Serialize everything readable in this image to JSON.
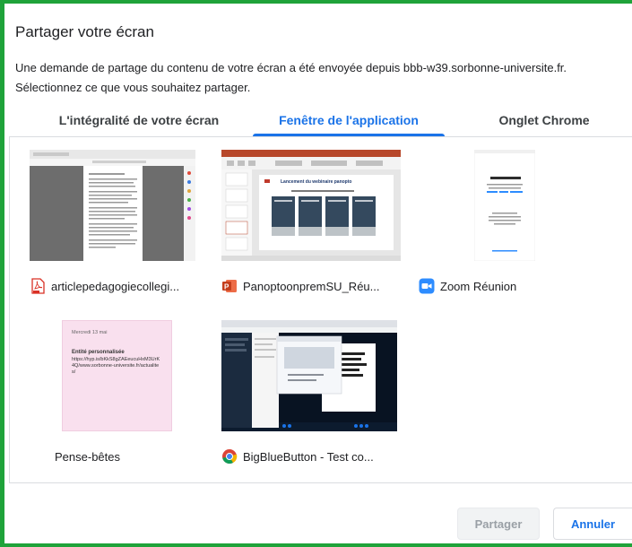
{
  "dialog": {
    "title": "Partager votre écran",
    "line1": "Une demande de partage du contenu de votre écran a été envoyée depuis bbb-w39.sorbonne-universite.fr.",
    "line2": "Sélectionnez ce que vous souhaitez partager."
  },
  "tabs": [
    {
      "label": "L'intégralité de votre écran",
      "active": false
    },
    {
      "label": "Fenêtre de l'application",
      "active": true
    },
    {
      "label": "Onglet Chrome",
      "active": false
    }
  ],
  "windows": [
    {
      "label": "articlepedagogiecollegi...",
      "icon": "pdf-icon"
    },
    {
      "label": "PanoptoonpremSU_Réu...",
      "icon": "powerpoint-icon"
    },
    {
      "label": "Zoom Réunion",
      "icon": "zoom-icon"
    },
    {
      "label": "Pense-bêtes",
      "icon": ""
    },
    {
      "label": "BigBlueButton - Test co...",
      "icon": "chrome-icon"
    }
  ],
  "thumbnails": {
    "ppt_slide_title": "Lancement du webinaire panopto",
    "sticky_header": "Mercredi 13 mai",
    "sticky_title": "Entité personnalisée",
    "sticky_url": "https://hyp.is/bKkS8gZAEeucuHxM3UrK4Q/www.sorbonne-universite.fr/actualites/"
  },
  "buttons": {
    "share": "Partager",
    "cancel": "Annuler"
  },
  "colors": {
    "accent": "#1a73e8",
    "frame": "#1fa33a"
  }
}
